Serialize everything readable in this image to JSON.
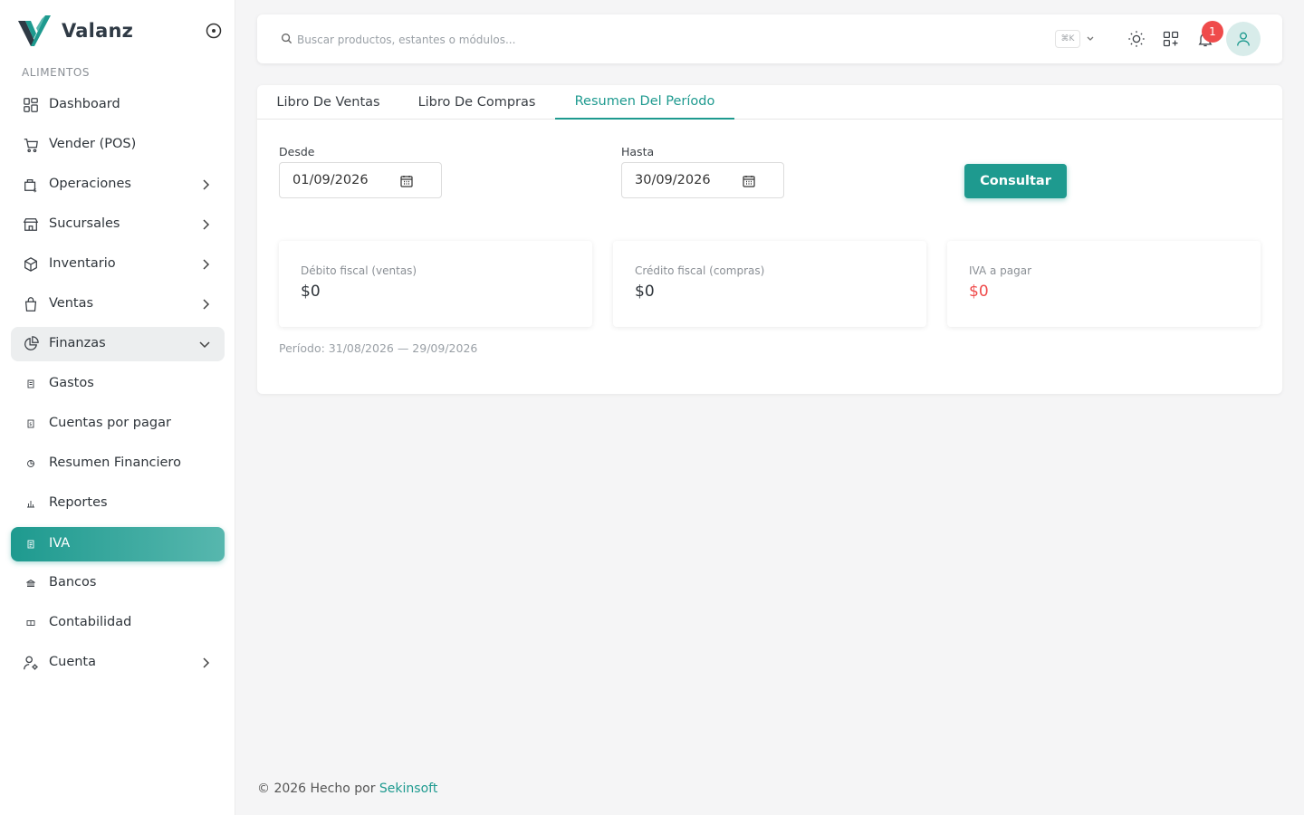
{
  "brand": {
    "name": "Valanz"
  },
  "sidebar": {
    "section_label": "ALIMENTOS",
    "items": [
      {
        "label": "Dashboard",
        "icon": "dashboard-icon"
      },
      {
        "label": "Vender (POS)",
        "icon": "cart-icon"
      },
      {
        "label": "Operaciones",
        "icon": "operations-icon"
      },
      {
        "label": "Sucursales",
        "icon": "store-icon"
      },
      {
        "label": "Inventario",
        "icon": "box-icon"
      },
      {
        "label": "Ventas",
        "icon": "bag-icon"
      },
      {
        "label": "Finanzas",
        "icon": "pie-icon"
      },
      {
        "label": "Gastos",
        "icon": "receipt-icon"
      },
      {
        "label": "Cuentas por pagar",
        "icon": "receipt-icon"
      },
      {
        "label": "Resumen Financiero",
        "icon": "pie-icon"
      },
      {
        "label": "Reportes",
        "icon": "bar-chart-icon"
      },
      {
        "label": "IVA",
        "icon": "receipt-icon"
      },
      {
        "label": "Bancos",
        "icon": "bank-icon"
      },
      {
        "label": "Contabilidad",
        "icon": "ledger-icon"
      },
      {
        "label": "Cuenta",
        "icon": "user-settings-icon"
      }
    ]
  },
  "topbar": {
    "search_placeholder": "Buscar productos, estantes o módulos...",
    "shortcut": "⌘K",
    "notification_count": "1"
  },
  "tabs": [
    {
      "label": "Libro De Ventas"
    },
    {
      "label": "Libro De Compras"
    },
    {
      "label": "Resumen Del Período"
    }
  ],
  "filters": {
    "from_label": "Desde",
    "from_value": "01/09/2026",
    "to_label": "Hasta",
    "to_value": "30/09/2026",
    "submit_label": "Consultar"
  },
  "stats": [
    {
      "title": "Débito fiscal (ventas)",
      "value": "$0"
    },
    {
      "title": "Crédito fiscal (compras)",
      "value": "$0"
    },
    {
      "title": "IVA a pagar",
      "value": "$0"
    }
  ],
  "periodo": "Período: 31/08/2026 — 29/09/2026",
  "footer": {
    "text": "© 2026 Hecho por ",
    "link": "Sekinsoft"
  },
  "colors": {
    "accent": "#1e9a8f",
    "danger": "#ef4b4b"
  }
}
